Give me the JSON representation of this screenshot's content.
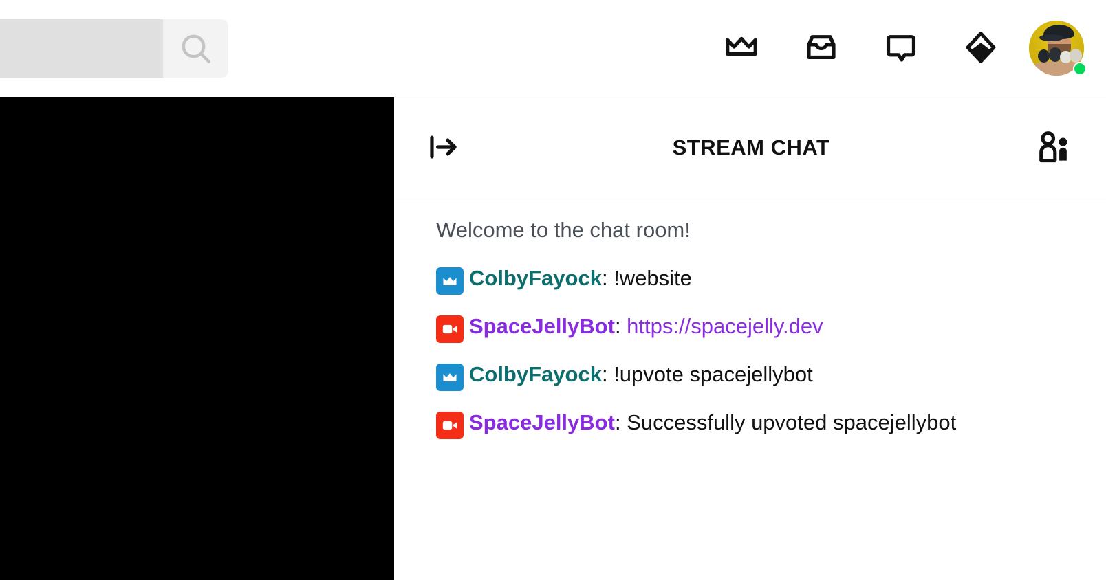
{
  "topbar": {
    "search": {
      "value": "",
      "placeholder": "",
      "icon": "search-icon",
      "button_label": ""
    },
    "nav_icons": [
      {
        "name": "crown-icon",
        "label": "Crown"
      },
      {
        "name": "inbox-icon",
        "label": "Inbox"
      },
      {
        "name": "chat-bubble-icon",
        "label": "Chat"
      },
      {
        "name": "gem-diamond-icon",
        "label": "Gem"
      }
    ],
    "avatar": {
      "name": "avatar",
      "alt": "User avatar",
      "status": "online",
      "status_color": "#00d959"
    }
  },
  "stage": {
    "name": "video-stage",
    "background": "#000000"
  },
  "chat": {
    "collapse_icon": "collapse-right-icon",
    "title": "STREAM CHAT",
    "users_icon": "users-icon",
    "welcome": "Welcome to the chat room!",
    "messages": [
      {
        "badge": "crown-badge",
        "badge_color": "#1b8ed0",
        "badge_icon": "crown-icon",
        "user": "ColbyFayock",
        "user_color": "#0d6e6e",
        "separator": ": ",
        "text": "!website",
        "text_color": "#111111",
        "is_link": false
      },
      {
        "badge": "video-badge",
        "badge_color": "#f42d16",
        "badge_icon": "video-camera-icon",
        "user": "SpaceJellyBot",
        "user_color": "#8a2be2",
        "separator": ": ",
        "text": "https://spacejelly.dev",
        "text_color": "#8a2be2",
        "is_link": true
      },
      {
        "badge": "crown-badge",
        "badge_color": "#1b8ed0",
        "badge_icon": "crown-icon",
        "user": "ColbyFayock",
        "user_color": "#0d6e6e",
        "separator": ": ",
        "text": "!upvote spacejellybot",
        "text_color": "#111111",
        "is_link": false
      },
      {
        "badge": "video-badge",
        "badge_color": "#f42d16",
        "badge_icon": "video-camera-icon",
        "user": "SpaceJellyBot",
        "user_color": "#8a2be2",
        "separator": ": ",
        "text": "Successfully upvoted spacejellybot",
        "text_color": "#111111",
        "is_link": false
      }
    ]
  },
  "colors": {
    "accent_teal": "#0d6e6e",
    "accent_purple": "#8a2be2",
    "badge_blue": "#1b8ed0",
    "badge_red": "#f42d16",
    "online_green": "#00d959",
    "border": "#ebebeb"
  }
}
